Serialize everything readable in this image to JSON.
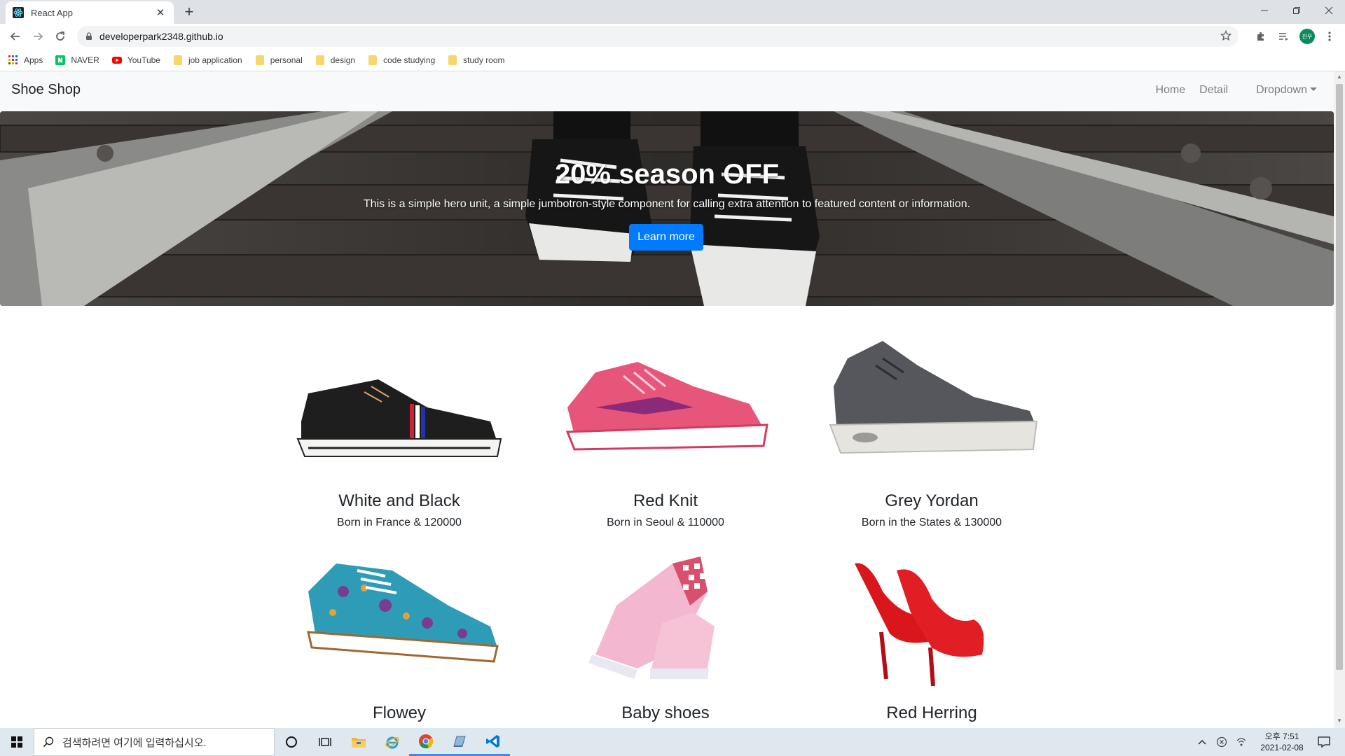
{
  "browser": {
    "tab_title": "React App",
    "url": "developerpark2348.github.io",
    "profile_initials": "진우",
    "bookmarks": [
      {
        "label": "Apps",
        "icon": "apps-grid-icon"
      },
      {
        "label": "NAVER",
        "icon": "naver-icon"
      },
      {
        "label": "YouTube",
        "icon": "youtube-icon"
      },
      {
        "label": "job application",
        "icon": "folder-icon"
      },
      {
        "label": "personal",
        "icon": "folder-icon"
      },
      {
        "label": "design",
        "icon": "folder-icon"
      },
      {
        "label": "code studying",
        "icon": "folder-icon"
      },
      {
        "label": "study room",
        "icon": "folder-icon"
      }
    ]
  },
  "navbar": {
    "brand": "Shoe Shop",
    "links": [
      "Home",
      "Detail",
      "Dropdown"
    ]
  },
  "hero": {
    "title": "20% season OFF",
    "lead": "This is a simple hero unit, a simple jumbotron-style component for calling extra attention to featured content or information.",
    "button": "Learn more"
  },
  "products": [
    {
      "name": "White and Black",
      "desc": "Born in France & 120000"
    },
    {
      "name": "Red Knit",
      "desc": "Born in Seoul & 110000"
    },
    {
      "name": "Grey Yordan",
      "desc": "Born in the States & 130000"
    },
    {
      "name": "Flowey",
      "desc": ""
    },
    {
      "name": "Baby shoes",
      "desc": ""
    },
    {
      "name": "Red Herring",
      "desc": ""
    }
  ],
  "taskbar": {
    "search_placeholder": "검색하려면 여기에 입력하십시오.",
    "time": "오후 7:51",
    "date": "2021-02-08"
  },
  "colors": {
    "primary_button": "#007bff",
    "navbar_bg": "#f8f9fa",
    "chrome_tabstrip": "#dee1e6",
    "taskbar_bg": "#dfe7ef"
  }
}
